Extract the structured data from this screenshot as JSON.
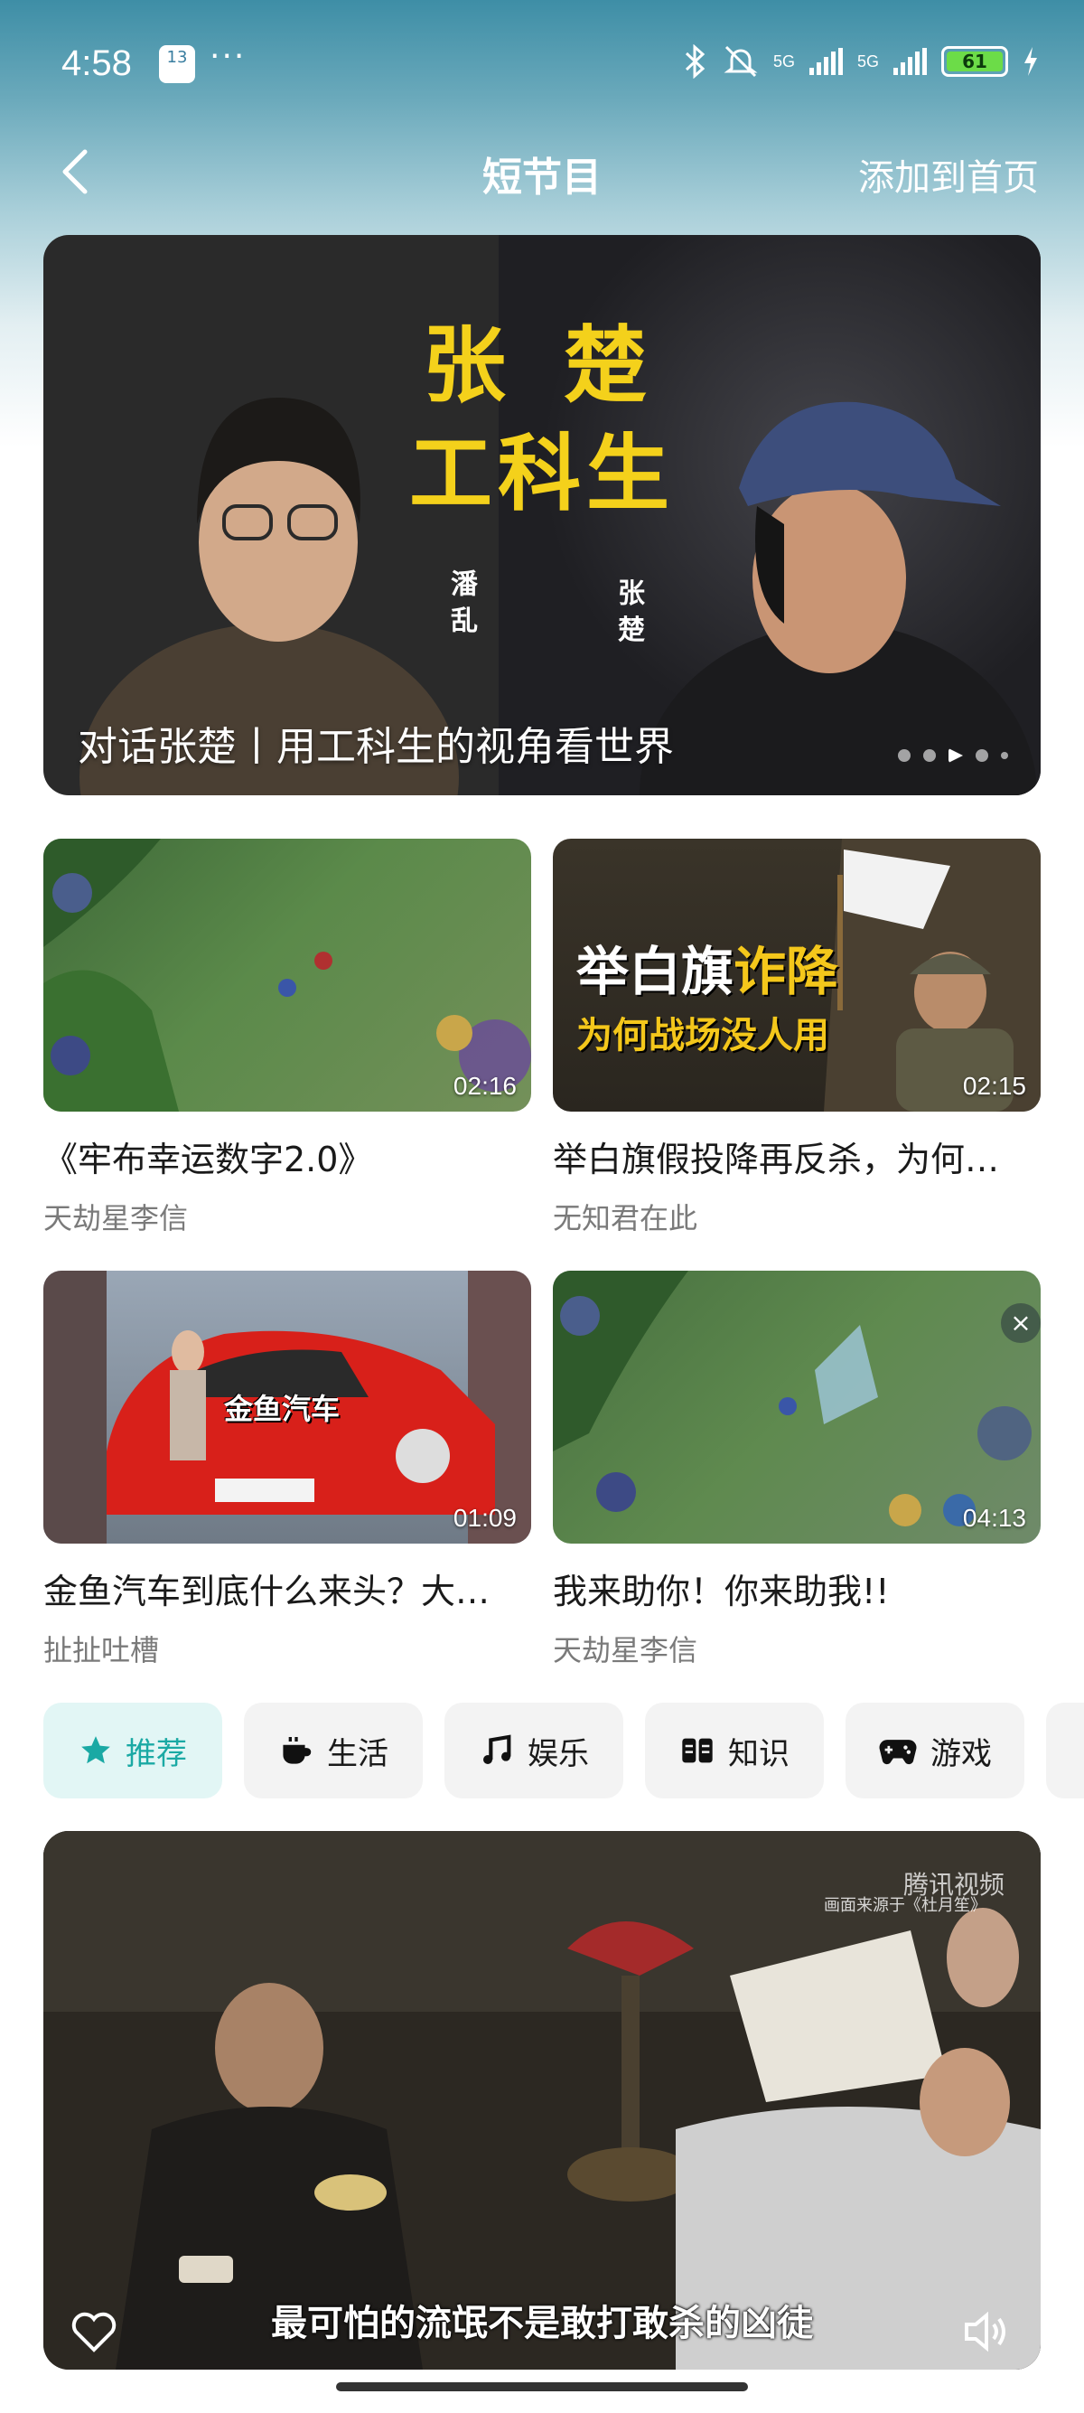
{
  "status": {
    "time": "4:58",
    "calendar_num": "13",
    "more": "···",
    "battery": "61",
    "net1": "5G",
    "net2": "5G"
  },
  "header": {
    "title": "短节目",
    "action": "添加到首页"
  },
  "banner": {
    "line1": "张 楚",
    "line2": "工科生",
    "caption": "对话张楚丨用工科生的视角看世界",
    "slides": 5,
    "active_slide": 3
  },
  "cards": [
    {
      "title": "《牢布幸运数字2.0》",
      "author": "天劫星李信",
      "duration": "02:16"
    },
    {
      "title": "举白旗假投降再反杀，为何…",
      "author": "无知君在此",
      "duration": "02:15",
      "thumb_line1": "举白旗",
      "thumb_line1b": "诈降",
      "thumb_line2": "为何战场没人用"
    },
    {
      "title": "金鱼汽车到底什么来头？大…",
      "author": "扯扯吐槽",
      "duration": "01:09",
      "thumb_label": "金鱼汽车"
    },
    {
      "title": " 我来助你！你来助我!!",
      "author": "天劫星李信",
      "duration": "04:13"
    }
  ],
  "tabs": [
    {
      "label": "推荐",
      "icon": "star-icon",
      "active": true
    },
    {
      "label": "生活",
      "icon": "coffee-cup-icon"
    },
    {
      "label": "娱乐",
      "icon": "music-note-icon"
    },
    {
      "label": "知识",
      "icon": "book-icon"
    },
    {
      "label": "游戏",
      "icon": "gamepad-icon"
    }
  ],
  "video": {
    "subtitle": "最可怕的流氓不是敢打敢杀的凶徒",
    "watermark": "腾讯视频",
    "source": "画面来源于《杜月笙》"
  },
  "colors": {
    "accent": "#1aa9a4",
    "banner_text": "#f4d11b",
    "header_bg": "#3e8ea6"
  }
}
